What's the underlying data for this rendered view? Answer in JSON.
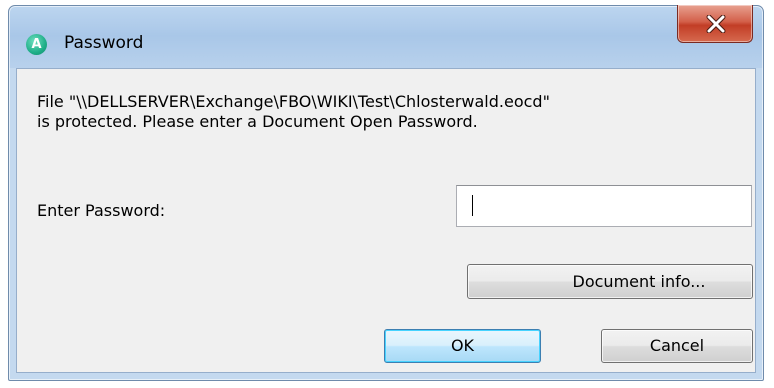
{
  "window": {
    "title": "Password",
    "app_icon_letter": "A",
    "close_icon": "close-x-icon"
  },
  "dialog": {
    "message_line1": "File \"\\\\DELLSERVER\\Exchange\\FBO\\WIKI\\Test\\Chlosterwald.eocd\"",
    "message_line2": "is protected. Please enter a Document Open Password.",
    "password_label": "Enter Password:",
    "password_value": "",
    "document_info_label": "Document info...",
    "ok_label": "OK",
    "cancel_label": "Cancel"
  },
  "colors": {
    "titlebar": "#b8d1ec",
    "client_bg": "#f0f0f0",
    "close_button": "#c94a33",
    "default_button_border": "#3c7fb1"
  }
}
